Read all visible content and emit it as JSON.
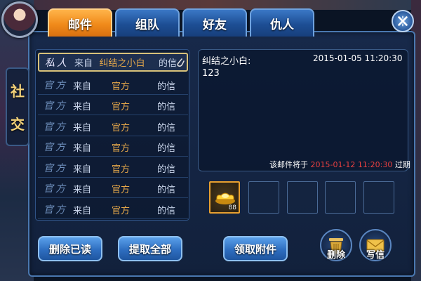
{
  "side_label": [
    "社",
    "交"
  ],
  "tabs": [
    {
      "label": "邮件",
      "active": true
    },
    {
      "label": "组队",
      "active": false
    },
    {
      "label": "好友",
      "active": false
    },
    {
      "label": "仇人",
      "active": false
    }
  ],
  "mail_list": [
    {
      "type": "私人",
      "from": "来自",
      "sender": "纠结之小白",
      "suffix": "的信",
      "selected": true,
      "has_attachment": true
    },
    {
      "type": "官方",
      "from": "来自",
      "sender": "官方",
      "suffix": "的信",
      "selected": false,
      "has_attachment": false
    },
    {
      "type": "官方",
      "from": "来自",
      "sender": "官方",
      "suffix": "的信",
      "selected": false,
      "has_attachment": false
    },
    {
      "type": "官方",
      "from": "来自",
      "sender": "官方",
      "suffix": "的信",
      "selected": false,
      "has_attachment": false
    },
    {
      "type": "官方",
      "from": "来自",
      "sender": "官方",
      "suffix": "的信",
      "selected": false,
      "has_attachment": false
    },
    {
      "type": "官方",
      "from": "来自",
      "sender": "官方",
      "suffix": "的信",
      "selected": false,
      "has_attachment": false
    },
    {
      "type": "官方",
      "from": "来自",
      "sender": "官方",
      "suffix": "的信",
      "selected": false,
      "has_attachment": false
    },
    {
      "type": "官方",
      "from": "来自",
      "sender": "官方",
      "suffix": "的信",
      "selected": false,
      "has_attachment": false
    }
  ],
  "detail": {
    "sender": "纠结之小白:",
    "time": "2015-01-05 11:20:30",
    "body": "123",
    "expire_prefix": "该邮件将于",
    "expire_date": "2015-01-12 11:20:30",
    "expire_suffix": "过期"
  },
  "attachments": [
    {
      "item": "gold-ingot-icon",
      "count": "88"
    },
    {
      "item": "",
      "count": ""
    },
    {
      "item": "",
      "count": ""
    },
    {
      "item": "",
      "count": ""
    },
    {
      "item": "",
      "count": ""
    }
  ],
  "buttons": {
    "delete_read": "删除已读",
    "take_all": "提取全部",
    "collect_attachment": "领取附件",
    "delete": "删除",
    "write": "写信"
  },
  "colors": {
    "active_tab": "#f08a1a",
    "tab": "#2e6ec0",
    "sender_highlight": "#e6a84a",
    "expire_date": "#e84040"
  }
}
